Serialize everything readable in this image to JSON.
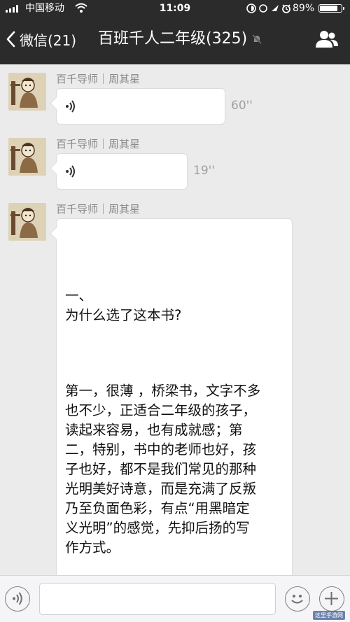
{
  "status_bar": {
    "carrier": "中国移动",
    "time": "11:09",
    "battery_text": "89%",
    "battery_level": 0.89
  },
  "nav": {
    "back_label": "微信(21)",
    "title": "百班千人二年级(325)",
    "icons": {
      "back": "chevron-left-icon",
      "mute": "mute-bell-icon",
      "members": "group-members-icon"
    }
  },
  "messages": [
    {
      "type": "voice",
      "sender": "百千导师｜周其星",
      "duration": "60''"
    },
    {
      "type": "voice",
      "sender": "百千导师｜周其星",
      "duration": "19''"
    },
    {
      "type": "text",
      "sender": "百千导师｜周其星",
      "lines": [
        "一、",
        "为什么选了这本书?",
        "",
        "",
        "第一，很薄 ，桥梁书，文字不多",
        "也不少，正适合二年级的孩子，",
        "读起来容易，也有成就感；第",
        "二，特别，书中的老师也好，孩",
        "子也好，都不是我们常见的那种",
        "光明美好诗意，而是充满了反叛",
        "乃至负面色彩，有点“用黑暗定",
        "义光明”的感觉，先抑后扬的写",
        "作方式。"
      ]
    }
  ],
  "input_bar": {
    "input_value": "",
    "icons": {
      "voice": "voice-input-icon",
      "emoji": "emoji-icon",
      "plus": "plus-icon"
    }
  },
  "watermark": "这里手游网",
  "colors": {
    "header_bg": "#2b2b2b",
    "chat_bg": "#ebebeb",
    "bubble_bg": "#ffffff",
    "sender_text": "#8a8a8a"
  }
}
